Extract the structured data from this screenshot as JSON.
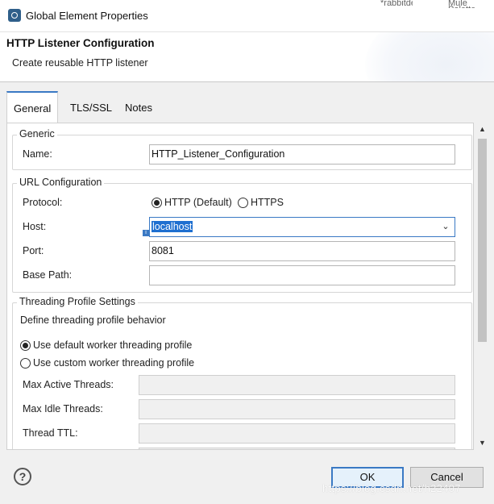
{
  "window": {
    "title": "Global Element Properties",
    "background_tabs": [
      "*rabbitdemo",
      "Mule Palette"
    ]
  },
  "banner": {
    "title": "HTTP Listener Configuration",
    "subtitle": "Create reusable HTTP listener"
  },
  "tabs": [
    {
      "label": "General",
      "active": true
    },
    {
      "label": "TLS/SSL",
      "active": false
    },
    {
      "label": "Notes",
      "active": false
    }
  ],
  "generic": {
    "title": "Generic",
    "name_label": "Name:",
    "name_value": "HTTP_Listener_Configuration"
  },
  "url": {
    "title": "URL Configuration",
    "protocol_label": "Protocol:",
    "protocol_options": [
      "HTTP (Default)",
      "HTTPS"
    ],
    "protocol_selected": "HTTP (Default)",
    "host_label": "Host:",
    "host_value": "localhost",
    "port_label": "Port:",
    "port_value": "8081",
    "base_path_label": "Base Path:",
    "base_path_value": ""
  },
  "threading": {
    "title": "Threading Profile Settings",
    "description": "Define threading profile behavior",
    "options": [
      "Use default worker threading profile",
      "Use custom worker threading profile"
    ],
    "selected": "Use default worker threading profile",
    "max_active_label": "Max Active Threads:",
    "max_idle_label": "Max Idle Threads:",
    "thread_ttl_label": "Thread TTL:"
  },
  "footer": {
    "ok_label": "OK",
    "cancel_label": "Cancel",
    "watermark": "https://blog.csdn.net/h22407"
  },
  "colors": {
    "accent": "#3a79c4",
    "selection": "#1e6fd0"
  }
}
